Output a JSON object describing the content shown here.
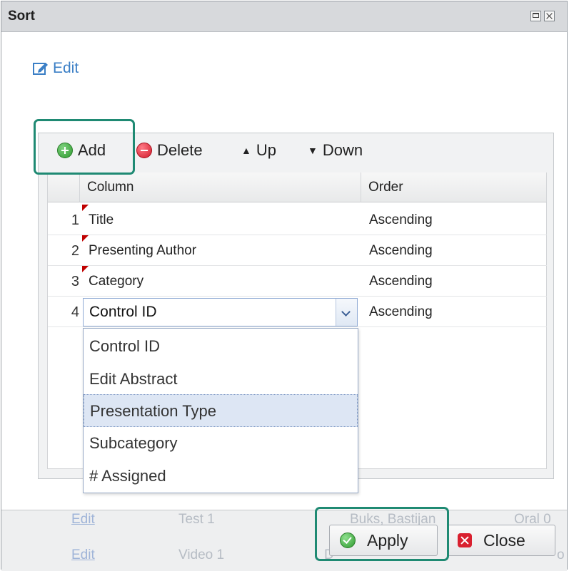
{
  "window": {
    "title": "Sort"
  },
  "edit_link": {
    "label": "Edit"
  },
  "toolbar": {
    "add": "Add",
    "delete": "Delete",
    "up": "Up",
    "down": "Down"
  },
  "grid": {
    "columns": [
      "Column",
      "Order"
    ],
    "rows": [
      {
        "num": "1",
        "column": "Title",
        "order": "Ascending"
      },
      {
        "num": "2",
        "column": "Presenting Author",
        "order": "Ascending"
      },
      {
        "num": "3",
        "column": "Category",
        "order": "Ascending"
      },
      {
        "num": "4",
        "column": "Control ID",
        "order": "Ascending"
      }
    ]
  },
  "dropdown": {
    "options": [
      "Control ID",
      "Edit Abstract",
      "Presentation Type",
      "Subcategory",
      "# Assigned"
    ],
    "highlighted": "Presentation Type"
  },
  "background_rows": [
    {
      "link": "Edit",
      "title": "Test 1",
      "author": "Buks, Bastijan",
      "type": "Oral 0"
    },
    {
      "link": "Edit",
      "title": "Video 1",
      "author": "D",
      "type": "o"
    }
  ],
  "footer": {
    "apply": "Apply",
    "close": "Close"
  },
  "colors": {
    "highlight_border": "#1f8a73",
    "link": "#3b7fc6",
    "selected_option": "#dde6f4"
  }
}
